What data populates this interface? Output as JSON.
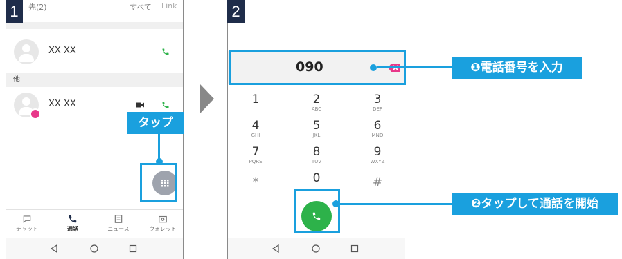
{
  "steps": {
    "step1": "1",
    "step2": "2"
  },
  "phone1": {
    "top_left_text": "先(2)",
    "top_mid_text": "すべて",
    "top_right_text": "Link",
    "section_other": "他",
    "contacts": [
      {
        "name": "XX  XX"
      },
      {
        "name": "XX  XX"
      }
    ],
    "callout_tap": "タップ",
    "nav": [
      {
        "label": "チャット",
        "icon": "chat-icon"
      },
      {
        "label": "通話",
        "icon": "phone-icon"
      },
      {
        "label": "ニュース",
        "icon": "news-icon"
      },
      {
        "label": "ウォレット",
        "icon": "wallet-icon"
      }
    ]
  },
  "phone2": {
    "dialed_number": "090",
    "keys": [
      {
        "digit": "1",
        "letters": ""
      },
      {
        "digit": "2",
        "letters": "ABC"
      },
      {
        "digit": "3",
        "letters": "DEF"
      },
      {
        "digit": "4",
        "letters": "GHI"
      },
      {
        "digit": "5",
        "letters": "JKL"
      },
      {
        "digit": "6",
        "letters": "MNO"
      },
      {
        "digit": "7",
        "letters": "PQRS"
      },
      {
        "digit": "8",
        "letters": "TUV"
      },
      {
        "digit": "9",
        "letters": "WXYZ"
      },
      {
        "digit": "*",
        "letters": ""
      },
      {
        "digit": "0",
        "letters": ""
      },
      {
        "digit": "#",
        "letters": ""
      }
    ]
  },
  "annotations": {
    "label1": "❶電話番号を入力",
    "label2": "❷タップして通話を開始"
  },
  "colors": {
    "accent": "#1aa0de",
    "badge": "#1f2d4a",
    "call_green": "#2db24a",
    "pink": "#e8388a"
  }
}
